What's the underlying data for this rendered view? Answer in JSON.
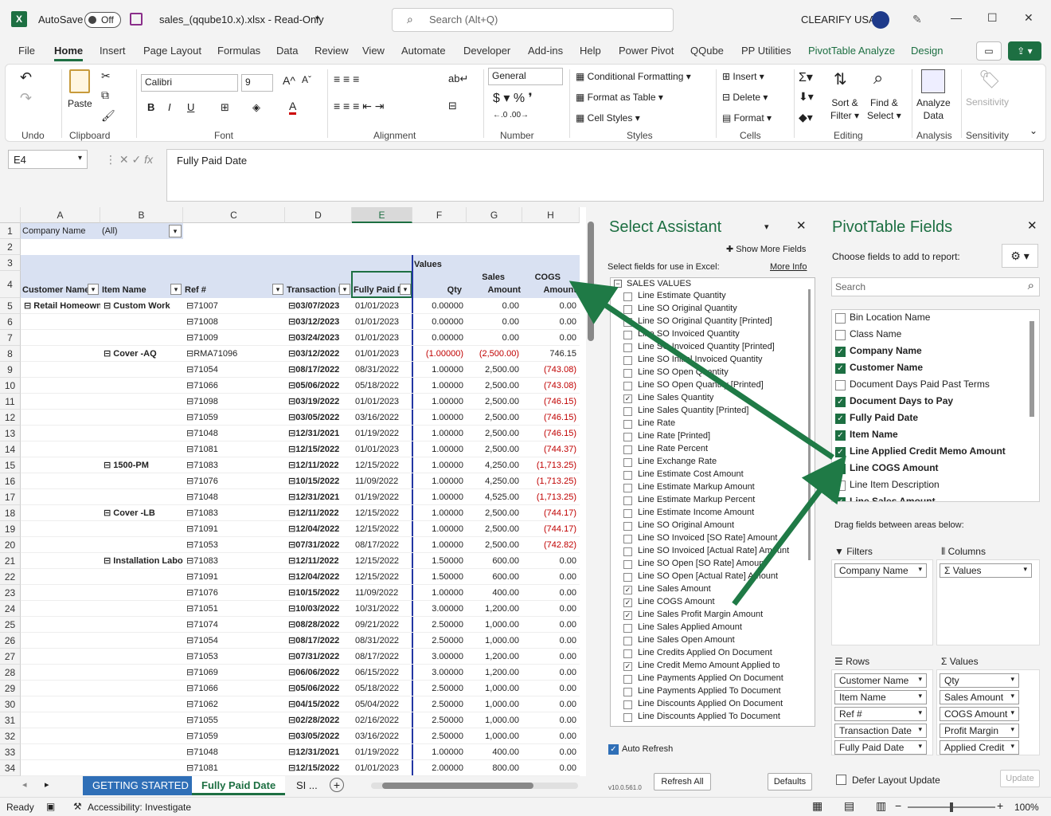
{
  "titlebar": {
    "autosave": "AutoSave",
    "toggle": "Off",
    "filename": "sales_(qqube10.x).xlsx  -  Read-Only",
    "search": "Search (Alt+Q)",
    "company": "CLEARIFY USA"
  },
  "tabs": [
    "File",
    "Home",
    "Insert",
    "Page Layout",
    "Formulas",
    "Data",
    "Review",
    "View",
    "Automate",
    "Developer",
    "Add-ins",
    "Help",
    "Power Pivot",
    "QQube",
    "PP Utilities",
    "PivotTable Analyze",
    "Design"
  ],
  "ribbon": {
    "undo": "Undo",
    "paste": "Paste",
    "clipboard": "Clipboard",
    "font_name": "Calibri",
    "font_size": "9",
    "font": "Font",
    "alignment": "Alignment",
    "number_format": "General",
    "number": "Number",
    "cond_format": "Conditional Formatting",
    "format_table": "Format as Table",
    "cell_styles": "Cell Styles",
    "styles": "Styles",
    "insert": "Insert",
    "delete": "Delete",
    "format": "Format",
    "cells": "Cells",
    "sort": "Sort &",
    "filter": "Filter",
    "find": "Find &",
    "select": "Select",
    "editing": "Editing",
    "analyze": "Analyze",
    "data": "Data",
    "analysis": "Analysis",
    "sensitivity": "Sensitivity"
  },
  "formula": {
    "namebox": "E4",
    "content": "Fully Paid Date"
  },
  "sheet": {
    "columns": [
      "A",
      "B",
      "C",
      "D",
      "E",
      "F",
      "G",
      "H"
    ],
    "filter_label": "Company Name",
    "filter_value": "(All)",
    "values_label": "Values",
    "headers": {
      "a": "Customer Name",
      "b": "Item Name",
      "c": "Ref #",
      "d": "Transaction D",
      "e": "Fully Paid D",
      "f": "Qty",
      "g1": "Sales",
      "g2": "Amount",
      "h1": "COGS",
      "h2": "Amount"
    },
    "rows": [
      {
        "n": "5",
        "a": "Retail Homeown",
        "b": "Custom Work",
        "c": "71007",
        "d": "03/07/2023",
        "e": "01/01/2023",
        "f": "0.00000",
        "g": "0.00",
        "h": "0.00"
      },
      {
        "n": "6",
        "c": "71008",
        "d": "03/12/2023",
        "e": "01/01/2023",
        "f": "0.00000",
        "g": "0.00",
        "h": "0.00"
      },
      {
        "n": "7",
        "c": "71009",
        "d": "03/24/2023",
        "e": "01/01/2023",
        "f": "0.00000",
        "g": "0.00",
        "h": "0.00"
      },
      {
        "n": "8",
        "b": "Cover -AQ",
        "c": "RMA71096",
        "d": "03/12/2022",
        "e": "01/01/2023",
        "f": "(1.00000)",
        "g": "(2,500.00)",
        "h": "746.15",
        "fr": true,
        "gr": true
      },
      {
        "n": "9",
        "c": "71054",
        "d": "08/17/2022",
        "e": "08/31/2022",
        "f": "1.00000",
        "g": "2,500.00",
        "h": "(743.08)",
        "hr": true
      },
      {
        "n": "10",
        "c": "71066",
        "d": "05/06/2022",
        "e": "05/18/2022",
        "f": "1.00000",
        "g": "2,500.00",
        "h": "(743.08)",
        "hr": true
      },
      {
        "n": "11",
        "c": "71098",
        "d": "03/19/2022",
        "e": "01/01/2023",
        "f": "1.00000",
        "g": "2,500.00",
        "h": "(746.15)",
        "hr": true
      },
      {
        "n": "12",
        "c": "71059",
        "d": "03/05/2022",
        "e": "03/16/2022",
        "f": "1.00000",
        "g": "2,500.00",
        "h": "(746.15)",
        "hr": true
      },
      {
        "n": "13",
        "c": "71048",
        "d": "12/31/2021",
        "e": "01/19/2022",
        "f": "1.00000",
        "g": "2,500.00",
        "h": "(746.15)",
        "hr": true
      },
      {
        "n": "14",
        "c": "71081",
        "d": "12/15/2022",
        "e": "01/01/2023",
        "f": "1.00000",
        "g": "2,500.00",
        "h": "(744.37)",
        "hr": true
      },
      {
        "n": "15",
        "b": "1500-PM",
        "c": "71083",
        "d": "12/11/2022",
        "e": "12/15/2022",
        "f": "1.00000",
        "g": "4,250.00",
        "h": "(1,713.25)",
        "hr": true
      },
      {
        "n": "16",
        "c": "71076",
        "d": "10/15/2022",
        "e": "11/09/2022",
        "f": "1.00000",
        "g": "4,250.00",
        "h": "(1,713.25)",
        "hr": true
      },
      {
        "n": "17",
        "c": "71048",
        "d": "12/31/2021",
        "e": "01/19/2022",
        "f": "1.00000",
        "g": "4,525.00",
        "h": "(1,713.25)",
        "hr": true
      },
      {
        "n": "18",
        "b": "Cover -LB",
        "c": "71083",
        "d": "12/11/2022",
        "e": "12/15/2022",
        "f": "1.00000",
        "g": "2,500.00",
        "h": "(744.17)",
        "hr": true
      },
      {
        "n": "19",
        "c": "71091",
        "d": "12/04/2022",
        "e": "12/15/2022",
        "f": "1.00000",
        "g": "2,500.00",
        "h": "(744.17)",
        "hr": true
      },
      {
        "n": "20",
        "c": "71053",
        "d": "07/31/2022",
        "e": "08/17/2022",
        "f": "1.00000",
        "g": "2,500.00",
        "h": "(742.82)",
        "hr": true
      },
      {
        "n": "21",
        "b": "Installation Labor",
        "c": "71083",
        "d": "12/11/2022",
        "e": "12/15/2022",
        "f": "1.50000",
        "g": "600.00",
        "h": "0.00"
      },
      {
        "n": "22",
        "c": "71091",
        "d": "12/04/2022",
        "e": "12/15/2022",
        "f": "1.50000",
        "g": "600.00",
        "h": "0.00"
      },
      {
        "n": "23",
        "c": "71076",
        "d": "10/15/2022",
        "e": "11/09/2022",
        "f": "1.00000",
        "g": "400.00",
        "h": "0.00"
      },
      {
        "n": "24",
        "c": "71051",
        "d": "10/03/2022",
        "e": "10/31/2022",
        "f": "3.00000",
        "g": "1,200.00",
        "h": "0.00"
      },
      {
        "n": "25",
        "c": "71074",
        "d": "08/28/2022",
        "e": "09/21/2022",
        "f": "2.50000",
        "g": "1,000.00",
        "h": "0.00"
      },
      {
        "n": "26",
        "c": "71054",
        "d": "08/17/2022",
        "e": "08/31/2022",
        "f": "2.50000",
        "g": "1,000.00",
        "h": "0.00"
      },
      {
        "n": "27",
        "c": "71053",
        "d": "07/31/2022",
        "e": "08/17/2022",
        "f": "3.00000",
        "g": "1,200.00",
        "h": "0.00"
      },
      {
        "n": "28",
        "c": "71069",
        "d": "06/06/2022",
        "e": "06/15/2022",
        "f": "3.00000",
        "g": "1,200.00",
        "h": "0.00"
      },
      {
        "n": "29",
        "c": "71066",
        "d": "05/06/2022",
        "e": "05/18/2022",
        "f": "2.50000",
        "g": "1,000.00",
        "h": "0.00"
      },
      {
        "n": "30",
        "c": "71062",
        "d": "04/15/2022",
        "e": "05/04/2022",
        "f": "2.50000",
        "g": "1,000.00",
        "h": "0.00"
      },
      {
        "n": "31",
        "c": "71055",
        "d": "02/28/2022",
        "e": "02/16/2022",
        "f": "2.50000",
        "g": "1,000.00",
        "h": "0.00"
      },
      {
        "n": "32",
        "c": "71059",
        "d": "03/05/2022",
        "e": "03/16/2022",
        "f": "2.50000",
        "g": "1,000.00",
        "h": "0.00"
      },
      {
        "n": "33",
        "c": "71048",
        "d": "12/31/2021",
        "e": "01/19/2022",
        "f": "1.00000",
        "g": "400.00",
        "h": "0.00"
      },
      {
        "n": "34",
        "c": "71081",
        "d": "12/15/2022",
        "e": "01/01/2023",
        "f": "2.00000",
        "g": "800.00",
        "h": "0.00"
      }
    ]
  },
  "sheettabs": {
    "t1": "GETTING STARTED",
    "t2": "Fully Paid Date",
    "t3": "SI ..."
  },
  "status": {
    "ready": "Ready",
    "access": "Accessibility: Investigate",
    "zoom": "100%"
  },
  "assistant": {
    "title": "Select Assistant",
    "show_more": "Show More Fields",
    "instruct": "Select fields for use in Excel:",
    "more_info": "More Info",
    "group": "SALES VALUES",
    "fields": [
      {
        "t": "Line Estimate Quantity",
        "c": false
      },
      {
        "t": "Line SO Original Quantity",
        "c": false
      },
      {
        "t": "Line SO Original Quantity [Printed]",
        "c": false
      },
      {
        "t": "Line SO Invoiced Quantity",
        "c": false
      },
      {
        "t": "Line SO Invoiced Quantity [Printed]",
        "c": false
      },
      {
        "t": "Line SO Initial Invoiced Quantity",
        "c": false
      },
      {
        "t": "Line SO Open Quantity",
        "c": false
      },
      {
        "t": "Line SO Open Quantity [Printed]",
        "c": false
      },
      {
        "t": "Line Sales Quantity",
        "c": true
      },
      {
        "t": "Line Sales Quantity [Printed]",
        "c": false
      },
      {
        "t": "Line Rate",
        "c": false
      },
      {
        "t": "Line Rate [Printed]",
        "c": false
      },
      {
        "t": "Line Rate Percent",
        "c": false
      },
      {
        "t": "Line Exchange Rate",
        "c": false
      },
      {
        "t": "Line Estimate Cost Amount",
        "c": false
      },
      {
        "t": "Line Estimate Markup Amount",
        "c": false
      },
      {
        "t": "Line Estimate Markup Percent",
        "c": false
      },
      {
        "t": "Line Estimate Income Amount",
        "c": false
      },
      {
        "t": "Line SO Original Amount",
        "c": false
      },
      {
        "t": "Line SO Invoiced [SO Rate] Amount",
        "c": false
      },
      {
        "t": "Line SO Invoiced [Actual Rate] Amount",
        "c": false
      },
      {
        "t": "Line SO Open [SO Rate] Amount",
        "c": false
      },
      {
        "t": "Line SO Open [Actual Rate] Amount",
        "c": false
      },
      {
        "t": "Line Sales Amount",
        "c": true
      },
      {
        "t": "Line COGS Amount",
        "c": true
      },
      {
        "t": "Line Sales Profit Margin Amount",
        "c": true
      },
      {
        "t": "Line Sales Applied Amount",
        "c": false
      },
      {
        "t": "Line Sales Open Amount",
        "c": false
      },
      {
        "t": "Line Credits Applied On Document",
        "c": false
      },
      {
        "t": "Line Credit Memo Amount Applied to",
        "c": true
      },
      {
        "t": "Line Payments Applied On Document",
        "c": false
      },
      {
        "t": "Line Payments Applied To Document",
        "c": false
      },
      {
        "t": "Line Discounts Applied On Document",
        "c": false
      },
      {
        "t": "Line Discounts Applied To Document",
        "c": false
      }
    ],
    "auto_refresh": "Auto Refresh",
    "version": "v10.0.561.0",
    "refresh_all": "Refresh All",
    "defaults": "Defaults"
  },
  "pivot": {
    "title": "PivotTable Fields",
    "choose": "Choose fields to add to report:",
    "search": "Search",
    "fields": [
      {
        "t": "Bin Location Name",
        "c": false
      },
      {
        "t": "Class Name",
        "c": false
      },
      {
        "t": "Company Name",
        "c": true
      },
      {
        "t": "Customer Name",
        "c": true
      },
      {
        "t": "Document Days Paid Past Terms",
        "c": false
      },
      {
        "t": "Document Days to Pay",
        "c": true
      },
      {
        "t": "Fully Paid Date",
        "c": true
      },
      {
        "t": "Item Name",
        "c": true
      },
      {
        "t": "Line Applied Credit Memo Amount",
        "c": true
      },
      {
        "t": "Line COGS Amount",
        "c": true
      },
      {
        "t": "Line Item Description",
        "c": false
      },
      {
        "t": "Line Sales Amount",
        "c": true
      }
    ],
    "drag": "Drag fields between areas below:",
    "filters": "Filters",
    "columns": "Columns",
    "rows_label": "Rows",
    "values_label": "Values",
    "filter_items": [
      "Company Name"
    ],
    "column_items": [
      "Σ Values"
    ],
    "row_items": [
      "Customer Name",
      "Item Name",
      "Ref #",
      "Transaction Date",
      "Fully Paid Date"
    ],
    "value_items": [
      "Qty",
      "Sales Amount",
      "COGS Amount",
      "Profit Margin",
      "Applied Credit"
    ],
    "defer": "Defer Layout Update",
    "update": "Update"
  },
  "colors": {
    "excel_green": "#1d6f42",
    "header_band": "#d9e1f2",
    "negative": "#c00000",
    "arrow": "#1f7a46"
  }
}
